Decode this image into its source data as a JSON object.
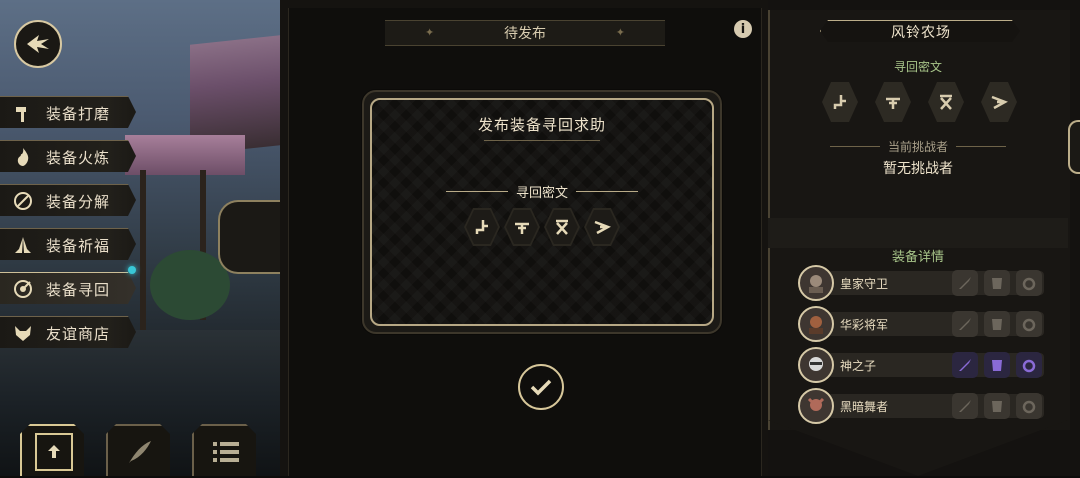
{
  "side_menu": {
    "items": [
      {
        "label": "装备打磨",
        "icon": "hammer-icon"
      },
      {
        "label": "装备火炼",
        "icon": "flame-icon"
      },
      {
        "label": "装备分解",
        "icon": "disassemble-icon"
      },
      {
        "label": "装备祈福",
        "icon": "pray-icon"
      },
      {
        "label": "装备寻回",
        "icon": "target-icon",
        "active": true
      },
      {
        "label": "友谊商店",
        "icon": "fox-icon"
      }
    ]
  },
  "center": {
    "pending_title": "待发布",
    "info_glyph": "i"
  },
  "modal": {
    "title": "发布装备寻回求助",
    "cipher_label": "寻回密文"
  },
  "right_panel": {
    "farm_name": "风铃农场",
    "cipher_label": "寻回密文",
    "current_challenger_label": "当前挑战者",
    "current_challenger_value": "暂无挑战者",
    "details_label": "装备详情",
    "characters": [
      {
        "name": "皇家守卫",
        "equipped": [
          false,
          false,
          false
        ]
      },
      {
        "name": "华彩将军",
        "equipped": [
          false,
          false,
          false
        ]
      },
      {
        "name": "神之子",
        "equipped": [
          true,
          true,
          true
        ]
      },
      {
        "name": "黑暗舞者",
        "equipped": [
          false,
          false,
          false
        ]
      }
    ]
  },
  "colors": {
    "accent_gold": "#d7c79a",
    "label_green": "#a8c58a",
    "equipped_purple": "#8a6bd6",
    "indicator_cyan": "#39c7d6"
  }
}
